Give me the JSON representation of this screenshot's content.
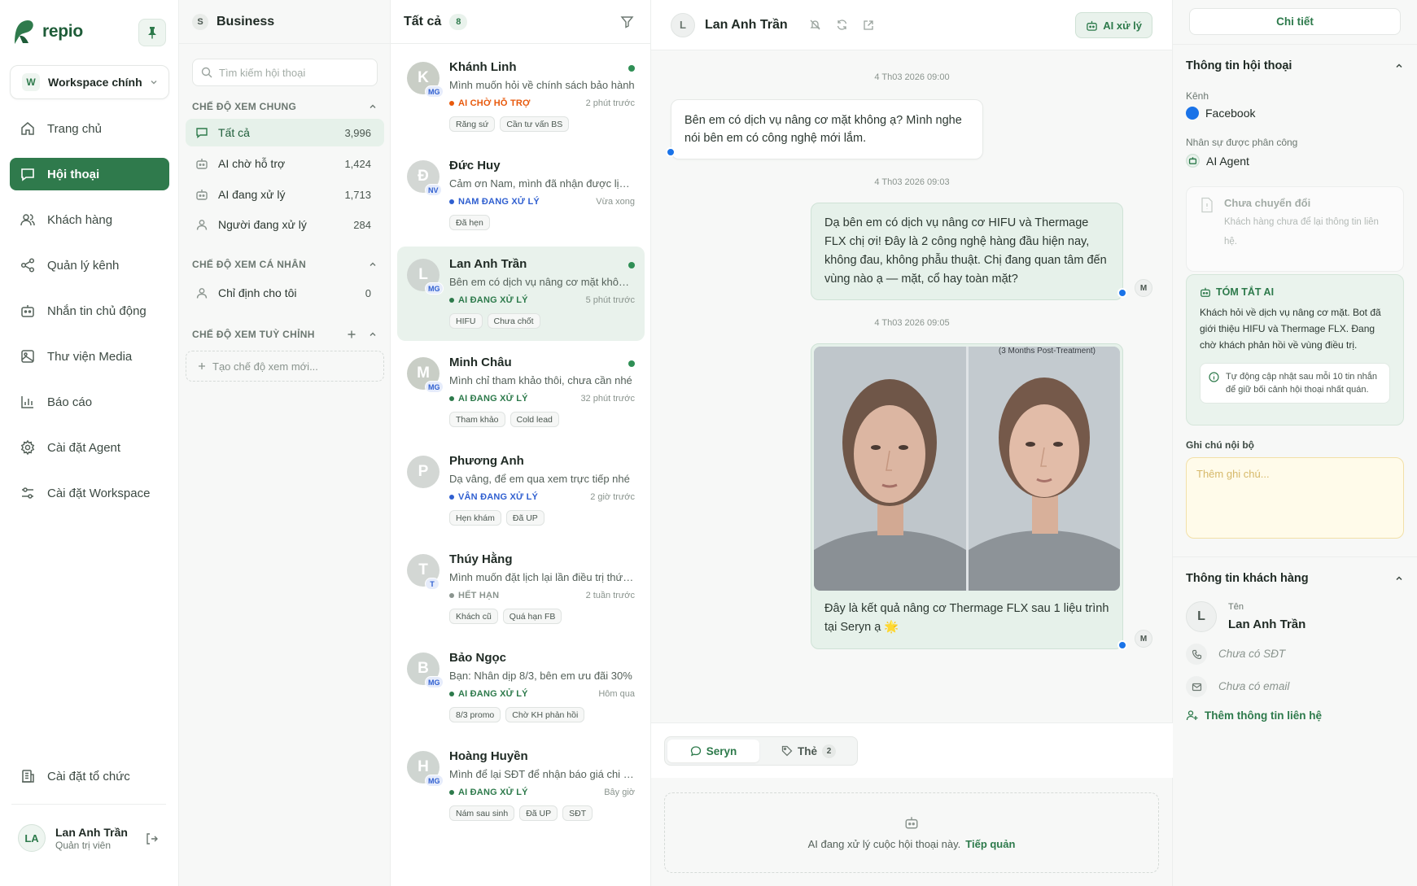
{
  "sidebar": {
    "brand": "repio",
    "workspace": {
      "badge": "W",
      "name": "Workspace chính"
    },
    "nav": [
      {
        "label": "Trang chủ",
        "icon": "home-icon"
      },
      {
        "label": "Hội thoại",
        "icon": "chat-icon",
        "active": true
      },
      {
        "label": "Khách hàng",
        "icon": "users-icon"
      },
      {
        "label": "Quản lý kênh",
        "icon": "share-icon"
      },
      {
        "label": "Nhắn tin chủ động",
        "icon": "robot-icon"
      },
      {
        "label": "Thư viện Media",
        "icon": "image-icon"
      },
      {
        "label": "Báo cáo",
        "icon": "chart-icon"
      },
      {
        "label": "Cài đặt Agent",
        "icon": "gear-icon"
      },
      {
        "label": "Cài đặt Workspace",
        "icon": "sliders-icon"
      }
    ],
    "org_settings": "Cài đặt tổ chức",
    "user": {
      "initials": "LA",
      "name": "Lan Anh Trần",
      "role": "Quản trị viên"
    }
  },
  "views": {
    "badge": "S",
    "title": "Business",
    "search_placeholder": "Tìm kiếm hội thoại",
    "general_title": "CHẾ ĐỘ XEM CHUNG",
    "general": [
      {
        "label": "Tất cả",
        "count": "3,996"
      },
      {
        "label": "AI chờ hỗ trợ",
        "count": "1,424"
      },
      {
        "label": "AI đang xử lý",
        "count": "1,713"
      },
      {
        "label": "Người đang xử lý",
        "count": "284"
      }
    ],
    "personal_title": "CHẾ ĐỘ XEM CÁ NHÂN",
    "personal": [
      {
        "label": "Chỉ định cho tôi",
        "count": "0"
      }
    ],
    "custom_title": "CHẾ ĐỘ XEM TUỲ CHỈNH",
    "new_view": "Tạo chế độ xem mới..."
  },
  "list": {
    "title": "Tất cả",
    "count": "8",
    "conversations": [
      {
        "initial": "K",
        "tag": "MG",
        "name": "Khánh Linh",
        "online": true,
        "preview": "Mình muốn hỏi về chính sách bảo hành",
        "status": "AI CHỜ HỖ TRỢ",
        "status_color": "#e8590c",
        "time": "2 phút trước",
        "tags": [
          "Răng sứ",
          "Cần tư vấn BS"
        ],
        "avatar_color": "#c9cec6"
      },
      {
        "initial": "Đ",
        "tag": "NV",
        "name": "Đức Huy",
        "online": false,
        "preview": "Cảm ơn Nam, mình đã nhận được lịch hẹn",
        "status": "NAM ĐANG XỬ LÝ",
        "status_color": "#2f5fd0",
        "time": "Vừa xong",
        "tags": [
          "Đã hẹn"
        ],
        "avatar_color": "#d3d7d4"
      },
      {
        "initial": "L",
        "tag": "MG",
        "name": "Lan Anh Trần",
        "online": true,
        "preview": "Bên em có dịch vụ nâng cơ mặt không ạ?",
        "status": "AI ĐANG XỬ LÝ",
        "status_color": "#2d7a4b",
        "time": "5 phút trước",
        "tags": [
          "HIFU",
          "Chưa chốt"
        ],
        "avatar_color": "#cfd5d1",
        "selected": true
      },
      {
        "initial": "M",
        "tag": "MG",
        "name": "Minh Châu",
        "online": true,
        "preview": "Mình chỉ tham khảo thôi, chưa cần nhé",
        "status": "AI ĐANG XỬ LÝ",
        "status_color": "#2d7a4b",
        "time": "32 phút trước",
        "tags": [
          "Tham khảo",
          "Cold lead"
        ],
        "avatar_color": "#c9cec6"
      },
      {
        "initial": "P",
        "tag": "",
        "name": "Phương Anh",
        "online": false,
        "preview": "Dạ vâng, để em qua xem trực tiếp nhé",
        "status": "VÂN ĐANG XỬ LÝ",
        "status_color": "#2f5fd0",
        "time": "2 giờ trước",
        "tags": [
          "Hẹn khám",
          "Đã UP"
        ],
        "avatar_color": "#d3d7d4"
      },
      {
        "initial": "T",
        "tag": "T",
        "name": "Thúy Hằng",
        "online": false,
        "preview": "Mình muốn đặt lịch lại lần điều trị thứ hai",
        "status": "HẾT HẠN",
        "status_color": "#8a948e",
        "time": "2 tuần trước",
        "tags": [
          "Khách cũ",
          "Quá hạn FB"
        ],
        "avatar_color": "#d3d7d4"
      },
      {
        "initial": "B",
        "tag": "MG",
        "name": "Bảo Ngọc",
        "online": false,
        "preview": "Bạn: Nhân dịp 8/3, bên em ưu đãi 30%",
        "status": "AI ĐANG XỬ LÝ",
        "status_color": "#2d7a4b",
        "time": "Hôm qua",
        "tags": [
          "8/3 promo",
          "Chờ KH phản hồi"
        ],
        "avatar_color": "#cfd5d1"
      },
      {
        "initial": "H",
        "tag": "MG",
        "name": "Hoàng Huyền",
        "online": false,
        "preview": "Mình để lại SĐT để nhận báo giá chi tiết",
        "status": "AI ĐANG XỬ LÝ",
        "status_color": "#2d7a4b",
        "time": "Bây giờ",
        "tags": [
          "Nám sau sinh",
          "Đã UP",
          "SĐT"
        ],
        "avatar_color": "#cfd5d1"
      }
    ]
  },
  "chat": {
    "avatar": "L",
    "name": "Lan Anh Trần",
    "ai_button": "AI xử lý",
    "messages": [
      {
        "time": "4 Th03 2026 09:00",
        "text": "Bên em có dịch vụ nâng cơ mặt không ạ? Mình nghe nói bên em có công nghệ mới lắm."
      },
      {
        "time": "4 Th03 2026 09:03",
        "text": "Dạ bên em có dịch vụ nâng cơ HIFU và Thermage FLX chị ơi! Đây là 2 công nghệ hàng đầu hiện nay, không đau, không phẫu thuật. Chị đang quan tâm đến vùng nào ạ — mặt, cổ hay toàn mặt?"
      },
      {
        "time": "4 Th03 2026 09:05",
        "photo_caption": "(3 Months Post-Treatment)",
        "text": "Đây là kết quả nâng cơ Thermage FLX sau 1 liệu trình tại Seryn ạ 🌟"
      }
    ],
    "agent_initial": "M",
    "tabs": [
      {
        "label": "Seryn"
      },
      {
        "label": "Thẻ",
        "count": "2"
      }
    ],
    "ai_notice": "AI đang xử lý cuộc hội thoại này.",
    "takeover": "Tiếp quản"
  },
  "details": {
    "tab": "Chi tiết",
    "conv_info_title": "Thông tin hội thoại",
    "channel_label": "Kênh",
    "channel": "Facebook",
    "assignee_label": "Nhân sự được phân công",
    "assignee": "AI Agent",
    "not_converted_title": "Chưa chuyển đổi",
    "not_converted_desc": "Khách hàng chưa để lại thông tin liên hệ.",
    "summary_title": "TÓM TẮT AI",
    "summary_text": "Khách hỏi về dịch vụ nâng cơ mặt. Bot đã giới thiệu HIFU và Thermage FLX. Đang chờ khách phản hồi về vùng điều trị.",
    "summary_note": "Tự động cập nhật sau mỗi 10 tin nhắn để giữ bối cảnh hội thoại nhất quán.",
    "note_label": "Ghi chú nội bộ",
    "note_placeholder": "Thêm ghi chú...",
    "customer_title": "Thông tin khách hàng",
    "customer_avatar": "L",
    "name_label": "Tên",
    "customer_name": "Lan Anh Trần",
    "no_phone": "Chưa có SĐT",
    "no_email": "Chưa có email",
    "add_contact": "Thêm thông tin liên hệ"
  }
}
